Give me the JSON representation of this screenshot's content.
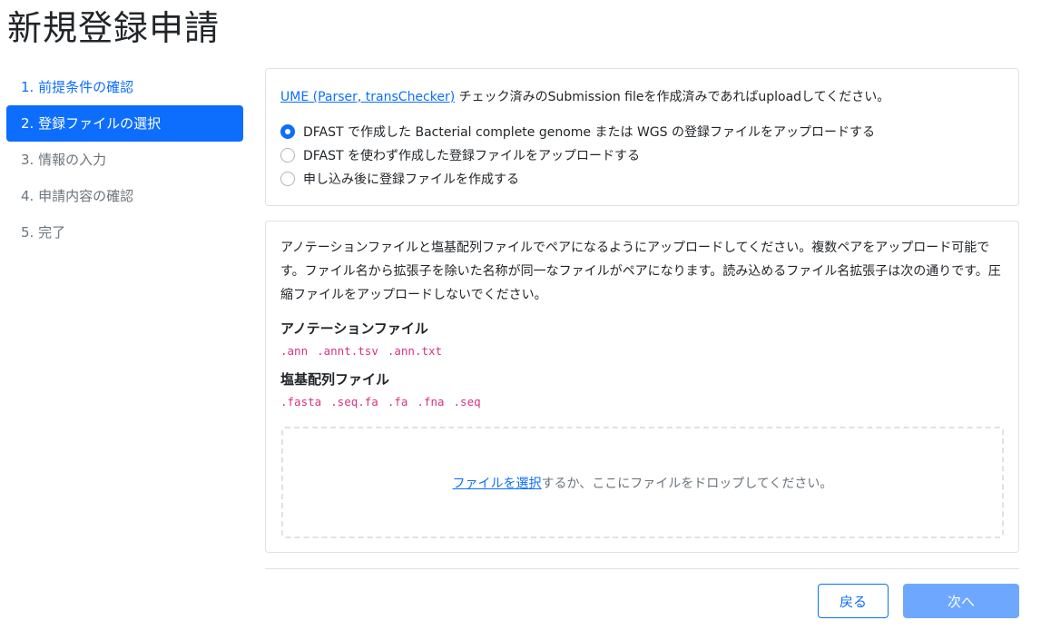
{
  "page": {
    "title": "新規登録申請"
  },
  "steps": [
    {
      "label": "1. 前提条件の確認",
      "state": "done"
    },
    {
      "label": "2. 登録ファイルの選択",
      "state": "active"
    },
    {
      "label": "3. 情報の入力",
      "state": "pending"
    },
    {
      "label": "4. 申請内容の確認",
      "state": "pending"
    },
    {
      "label": "5. 完了",
      "state": "pending"
    }
  ],
  "upload_options": {
    "intro_link": "UME (Parser, transChecker)",
    "intro_text": " チェック済みのSubmission fileを作成済みであればuploadしてください。",
    "options": [
      {
        "label": "DFAST で作成した Bacterial complete genome または WGS の登録ファイルをアップロードする",
        "checked": true
      },
      {
        "label": "DFAST を使わず作成した登録ファイルをアップロードする",
        "checked": false
      },
      {
        "label": "申し込み後に登録ファイルを作成する",
        "checked": false
      }
    ]
  },
  "file_section": {
    "description": "アノテーションファイルと塩基配列ファイルでペアになるようにアップロードしてください。複数ペアをアップロード可能です。ファイル名から拡張子を除いた名称が同一なファイルがペアになります。読み込めるファイル名拡張子は次の通りです。圧縮ファイルをアップロードしないでください。",
    "annotation_title": "アノテーションファイル",
    "annotation_exts": [
      ".ann",
      ".annt.tsv",
      ".ann.txt"
    ],
    "sequence_title": "塩基配列ファイル",
    "sequence_exts": [
      ".fasta",
      ".seq.fa",
      ".fa",
      ".fna",
      ".seq"
    ],
    "dropzone_link": "ファイルを選択",
    "dropzone_text": "するか、ここにファイルをドロップしてください。"
  },
  "buttons": {
    "back": "戻る",
    "next": "次へ"
  },
  "colors": {
    "primary": "#0d6efd",
    "primary_disabled": "#6ea8fe",
    "code": "#d63384"
  }
}
